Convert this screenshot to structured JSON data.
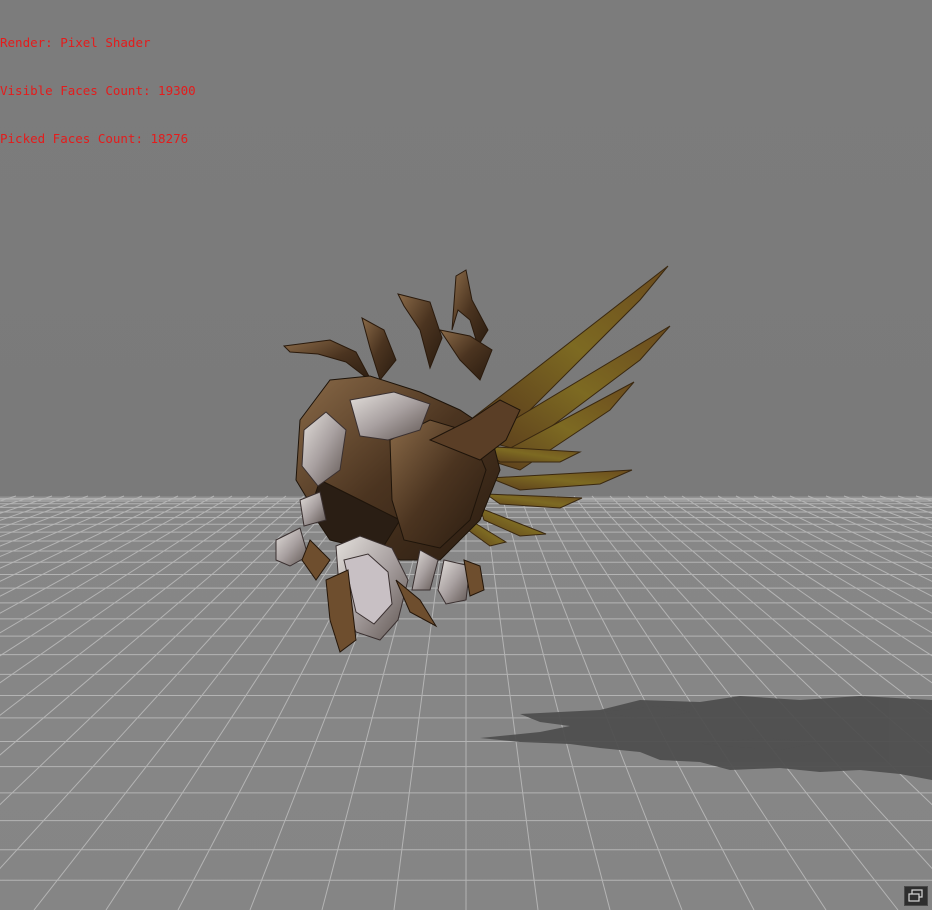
{
  "hud": {
    "render_line": "Render: Pixel Shader",
    "visible_faces_line": "Visible Faces Count: 19300",
    "picked_faces_line": "Picked Faces Count: 18276"
  },
  "colors": {
    "background": "#7b7b7b",
    "hud_text": "#e41c1c",
    "grid_line": "#b8b8b8",
    "shadow": "#4e4e4e",
    "model_bronze": "#6a4a2a",
    "model_silver": "#b8b0a8",
    "wing_feather": "#7c6a20"
  },
  "viewport": {
    "content": "3d-model-winged-armored-creature",
    "floor": "perspective-grid"
  },
  "controls": {
    "maximize_icon": "restore-window-icon"
  }
}
